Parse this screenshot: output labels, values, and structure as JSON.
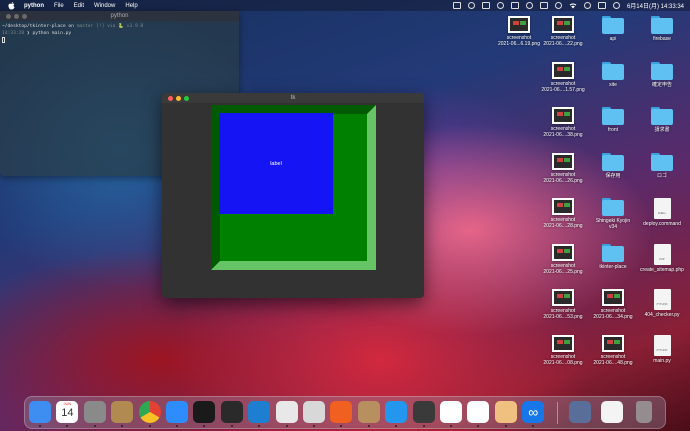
{
  "menubar": {
    "app_name": "python",
    "menus": [
      "File",
      "Edit",
      "Window",
      "Help"
    ],
    "datetime": "6月14日(月)  14:33:34"
  },
  "terminal": {
    "title": "python",
    "line1": "~/desktop/tkinter-place on ",
    "line1_branch": "master [!] via 🐍 v3.9.0",
    "line2_time": "14:33:20",
    "line2_cmd": " ❯ python main.py"
  },
  "tk_window": {
    "title": "tk",
    "label_text": "label",
    "frame_color": "#008000",
    "label_color": "#1414f5"
  },
  "desktop": {
    "col1": [
      {
        "name": "screenshot 2021-06...6.19.png",
        "type": "image"
      }
    ],
    "col2": [
      {
        "name": "screenshot 2021-06....22.png",
        "type": "image"
      },
      {
        "name": "screenshot 2021-06....1.57.png",
        "type": "image"
      },
      {
        "name": "screenshot 2021-06....38.png",
        "type": "image"
      },
      {
        "name": "screenshot 2021-06....26.png",
        "type": "image"
      },
      {
        "name": "screenshot 2021-06....28.png",
        "type": "image"
      },
      {
        "name": "screenshot 2021-06....25.png",
        "type": "image"
      },
      {
        "name": "screenshot 2021-06....53.png",
        "type": "image"
      },
      {
        "name": "screenshot 2021-06....08.png",
        "type": "image"
      }
    ],
    "col3": [
      {
        "name": "api",
        "type": "folder"
      },
      {
        "name": "site",
        "type": "folder"
      },
      {
        "name": "front",
        "type": "folder"
      },
      {
        "name": "保存用",
        "type": "folder"
      },
      {
        "name": "Shingeki Kyojin v34",
        "type": "folder"
      },
      {
        "name": "tkinter-place",
        "type": "folder"
      },
      {
        "name": "screenshot 2021-06....34.png",
        "type": "image"
      },
      {
        "name": "screenshot 2021-06....48.png",
        "type": "image"
      }
    ],
    "col4": [
      {
        "name": "firebase",
        "type": "folder"
      },
      {
        "name": "確定申告",
        "type": "folder"
      },
      {
        "name": "請求書",
        "type": "folder"
      },
      {
        "name": "ロゴ",
        "type": "folder"
      },
      {
        "name": "deploy.command",
        "type": "doc",
        "badge": "SHELL"
      },
      {
        "name": "create_sitemap.php",
        "type": "doc",
        "badge": "PHP"
      },
      {
        "name": "404_checker.py",
        "type": "doc",
        "badge": "PYTHON"
      },
      {
        "name": "main.py",
        "type": "doc",
        "badge": "PYTHON"
      }
    ]
  },
  "dock": {
    "calendar_day": "14",
    "calendar_month": "JUN",
    "apps": [
      {
        "name": "finder-icon",
        "color": "#3d8ef0"
      },
      {
        "name": "calendar-icon",
        "color": "#ffffff"
      },
      {
        "name": "system-preferences-icon",
        "color": "#8a8a8a"
      },
      {
        "name": "archive-utility-icon",
        "color": "#b08a50"
      },
      {
        "name": "chrome-icon",
        "color": "#e6e6e6"
      },
      {
        "name": "zoom-icon",
        "color": "#2d8cff"
      },
      {
        "name": "iterm-icon",
        "color": "#1a1a1a"
      },
      {
        "name": "terminal-icon",
        "color": "#2a2a2a"
      },
      {
        "name": "vscode-icon",
        "color": "#1e7fd0"
      },
      {
        "name": "safari-icon",
        "color": "#e8e8e8"
      },
      {
        "name": "sequel-pro-icon",
        "color": "#d8d8d8"
      },
      {
        "name": "activity-monitor-icon",
        "color": "#f06020"
      },
      {
        "name": "archive-app-icon",
        "color": "#b89060"
      },
      {
        "name": "docker-icon",
        "color": "#2396ed"
      },
      {
        "name": "quicktime-icon",
        "color": "#3a3a3a"
      },
      {
        "name": "sourcetree-icon",
        "color": "#ffffff"
      },
      {
        "name": "github-desktop-icon",
        "color": "#ffffff"
      },
      {
        "name": "preview-icon",
        "color": "#f0c080"
      },
      {
        "name": "infinity-icon",
        "color": "#1877e8"
      }
    ],
    "tray": [
      {
        "name": "downloads-stack-icon",
        "color": "#5a6e9a"
      },
      {
        "name": "documents-stack-icon",
        "color": "#f4f4f4"
      },
      {
        "name": "trash-icon",
        "color": "#9a9a9a"
      }
    ]
  }
}
